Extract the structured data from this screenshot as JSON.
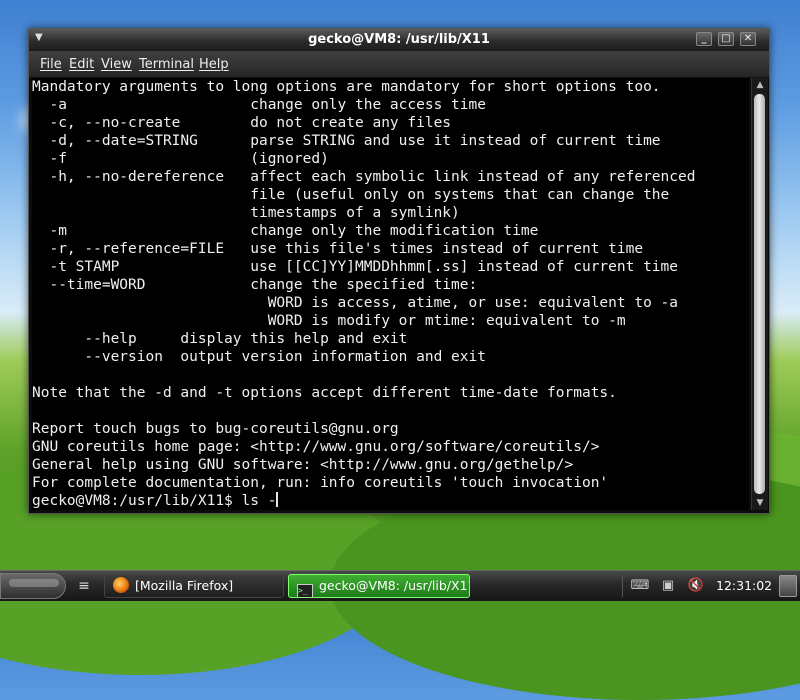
{
  "window": {
    "title": "gecko@VM8: /usr/lib/X11",
    "menu": [
      "File",
      "Edit",
      "View",
      "Terminal",
      "Help"
    ]
  },
  "terminal": {
    "lines": [
      "Mandatory arguments to long options are mandatory for short options too.",
      "  -a                     change only the access time",
      "  -c, --no-create        do not create any files",
      "  -d, --date=STRING      parse STRING and use it instead of current time",
      "  -f                     (ignored)",
      "  -h, --no-dereference   affect each symbolic link instead of any referenced",
      "                         file (useful only on systems that can change the",
      "                         timestamps of a symlink)",
      "  -m                     change only the modification time",
      "  -r, --reference=FILE   use this file's times instead of current time",
      "  -t STAMP               use [[CC]YY]MMDDhhmm[.ss] instead of current time",
      "  --time=WORD            change the specified time:",
      "                           WORD is access, atime, or use: equivalent to -a",
      "                           WORD is modify or mtime: equivalent to -m",
      "      --help     display this help and exit",
      "      --version  output version information and exit",
      "",
      "Note that the -d and -t options accept different time-date formats.",
      "",
      "Report touch bugs to bug-coreutils@gnu.org",
      "GNU coreutils home page: <http://www.gnu.org/software/coreutils/>",
      "General help using GNU software: <http://www.gnu.org/gethelp/>",
      "For complete documentation, run: info coreutils 'touch invocation'"
    ],
    "prompt": "gecko@VM8:/usr/lib/X11$ ls -"
  },
  "taskbar": {
    "tasks": [
      {
        "label": "[Mozilla Firefox]",
        "icon": "firefox-icon"
      },
      {
        "label": "gecko@VM8: /usr/lib/X11",
        "icon": "terminal-icon"
      }
    ],
    "clock": "12:31:02",
    "tray_icons": [
      "keyboard-icon",
      "network-icon",
      "volume-muted-icon"
    ]
  }
}
